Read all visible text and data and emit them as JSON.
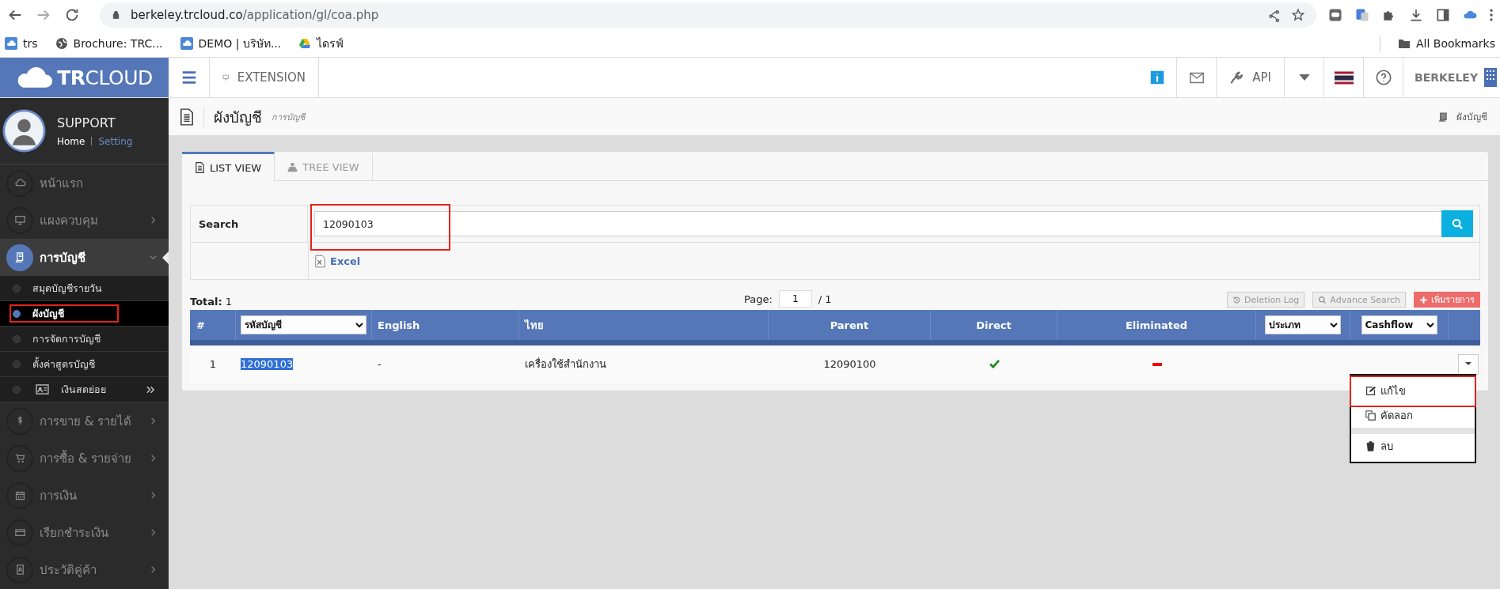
{
  "browser": {
    "url_host": "berkeley.trcloud.co",
    "url_path": "/application/gl/coa.php",
    "bookmarks": [
      {
        "label": "trs"
      },
      {
        "label": "Brochure: TRC..."
      },
      {
        "label": "DEMO | บริษัท..."
      },
      {
        "label": "ไดรฟ์"
      }
    ],
    "all_bookmarks": "All Bookmarks"
  },
  "topbar": {
    "logo_bold": "TR",
    "logo_rest": "CLOUD",
    "extension": "EXTENSION",
    "api": "API",
    "company": "BERKELEY"
  },
  "user": {
    "name": "SUPPORT",
    "home": "Home",
    "setting": "Setting"
  },
  "menu": [
    {
      "label": "หน้าแรก",
      "has_arrow": false,
      "selected": false,
      "expanded": false
    },
    {
      "label": "แผงควบคุม",
      "has_arrow": true,
      "selected": false,
      "expanded": false
    },
    {
      "label": "การบัญชี",
      "has_arrow": true,
      "selected": true,
      "expanded": true,
      "children": [
        {
          "label": "สมุดบัญชีรายวัน",
          "kind": "link",
          "selected": false
        },
        {
          "label": "ผังบัญชี",
          "kind": "link",
          "selected": true
        },
        {
          "label": "การจัดการบัญชี",
          "kind": "link",
          "selected": false
        },
        {
          "label": "ตั้งค่าสูตรบัญชี",
          "kind": "link",
          "selected": false
        },
        {
          "label": "เงินสดย่อย",
          "kind": "submenu",
          "selected": false
        }
      ]
    },
    {
      "label": "การขาย & รายได้",
      "has_arrow": true,
      "selected": false,
      "expanded": false
    },
    {
      "label": "การซื้อ & รายจ่าย",
      "has_arrow": true,
      "selected": false,
      "expanded": false
    },
    {
      "label": "การเงิน",
      "has_arrow": true,
      "selected": false,
      "expanded": false
    },
    {
      "label": "เรียกชำระเงิน",
      "has_arrow": true,
      "selected": false,
      "expanded": false
    },
    {
      "label": "ประวัติคู่ค้า",
      "has_arrow": true,
      "selected": false,
      "expanded": false
    }
  ],
  "page": {
    "title": "ผังบัญชี",
    "subtitle": "การบัญชี",
    "breadcrumb": "ผังบัญชี"
  },
  "tabs": [
    {
      "label": "LIST VIEW",
      "selected": true
    },
    {
      "label": "TREE VIEW",
      "selected": false
    }
  ],
  "search": {
    "label": "Search",
    "value": "12090103",
    "excel": "Excel"
  },
  "summary": {
    "total": "**Total:** 1",
    "page_label": "Page:",
    "page_value": "1",
    "page_count": "/ 1"
  },
  "buttons": [
    {
      "label": "Deletion Log",
      "kind": "log"
    },
    {
      "label": "Advance Search",
      "kind": "search"
    },
    {
      "label": "เพิ่มรายการ",
      "kind": "add"
    }
  ],
  "table": {
    "columns": [
      {
        "label": "#",
        "kind": "text"
      },
      {
        "label": "รหัสบัญชี",
        "kind": "select"
      },
      {
        "label": "English",
        "kind": "text"
      },
      {
        "label": "ไทย",
        "kind": "text"
      },
      {
        "label": "Parent",
        "kind": "text"
      },
      {
        "label": "Direct",
        "kind": "text"
      },
      {
        "label": "Eliminated",
        "kind": "text"
      },
      {
        "label": "ประเภท",
        "kind": "select"
      },
      {
        "label": "Cashflow",
        "kind": "select"
      }
    ],
    "rows": [
      {
        "number": "1",
        "code": "12090103",
        "code_highlighted": true,
        "english": "-",
        "thai": "เครื่องใช้สำนักงาน",
        "parent": "12090100",
        "direct": true,
        "eliminated": false
      }
    ]
  },
  "action_menu": [
    {
      "label": "แก้ไข",
      "kind": "edit"
    },
    {
      "label": "คัดลอก",
      "kind": "copy"
    },
    {
      "kind": "divider"
    },
    {
      "label": "ลบ",
      "kind": "delete"
    }
  ]
}
